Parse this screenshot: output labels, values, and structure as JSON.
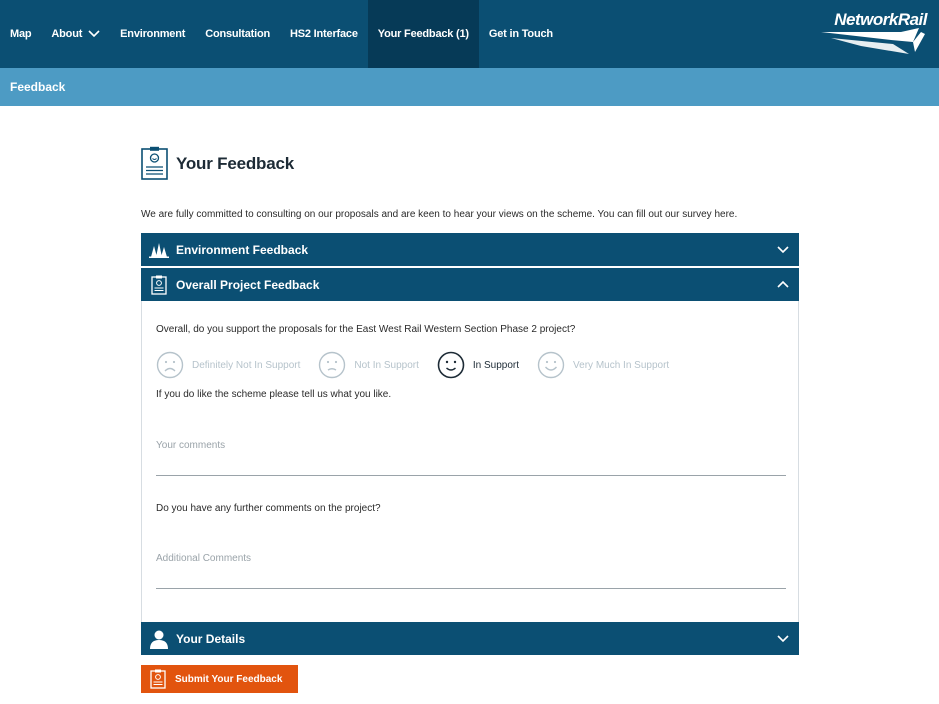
{
  "nav": {
    "items": [
      {
        "label": "Map"
      },
      {
        "label": "About"
      },
      {
        "label": "Environment"
      },
      {
        "label": "Consultation"
      },
      {
        "label": "HS2 Interface"
      },
      {
        "label": "Your Feedback (1)"
      },
      {
        "label": "Get in Touch"
      }
    ],
    "logo_text": "NetworkRail"
  },
  "subbar": {
    "title": "Feedback"
  },
  "page": {
    "title": "Your Feedback",
    "intro": "We are fully committed to consulting on our proposals and are keen to hear your views on the scheme. You can fill out our survey here."
  },
  "sections": {
    "environment": {
      "label": "Environment Feedback"
    },
    "overall": {
      "label": "Overall Project Feedback"
    },
    "details": {
      "label": "Your Details"
    }
  },
  "overall": {
    "question": "Overall, do you support the proposals for the East West Rail Western Section Phase 2 project?",
    "options": [
      {
        "label": "Definitely Not In Support"
      },
      {
        "label": "Not In Support"
      },
      {
        "label": "In Support"
      },
      {
        "label": "Very Much In Support"
      }
    ],
    "selected": "In Support",
    "like_prompt": "If you do like the scheme please tell us what you like.",
    "comments_placeholder": "Your comments",
    "further_prompt": "Do you have any further comments on the project?",
    "additional_placeholder": "Additional Comments"
  },
  "submit": {
    "label": "Submit Your Feedback"
  },
  "colors": {
    "navy": "#0b4f73",
    "nav_active": "#063a57",
    "subbar": "#4d9bc4",
    "accent": "#e2540e",
    "muted": "#b6c3cb"
  }
}
